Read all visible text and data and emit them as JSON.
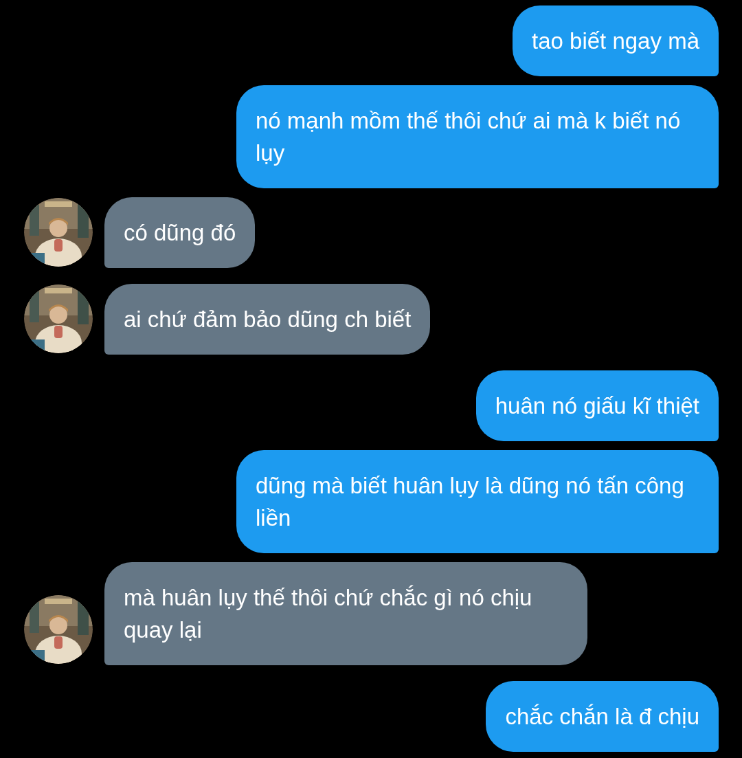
{
  "messages": [
    {
      "kind": "sent",
      "text": "tao biết ngay mà"
    },
    {
      "kind": "sent",
      "text": "nó mạnh mồm thế thôi chứ ai mà k biết nó lụy"
    },
    {
      "kind": "received",
      "text": "có dũng đó"
    },
    {
      "kind": "received",
      "text": "ai chứ đảm bảo dũng ch biết"
    },
    {
      "kind": "sent",
      "text": "huân nó giấu kĩ thiệt"
    },
    {
      "kind": "sent",
      "text": "dũng mà biết huân lụy là dũng nó tấn công liền"
    },
    {
      "kind": "received",
      "text": "mà huân lụy thế thôi chứ chắc gì nó chịu quay lại"
    },
    {
      "kind": "sent",
      "text": "chắc chắn là đ chịu"
    }
  ]
}
